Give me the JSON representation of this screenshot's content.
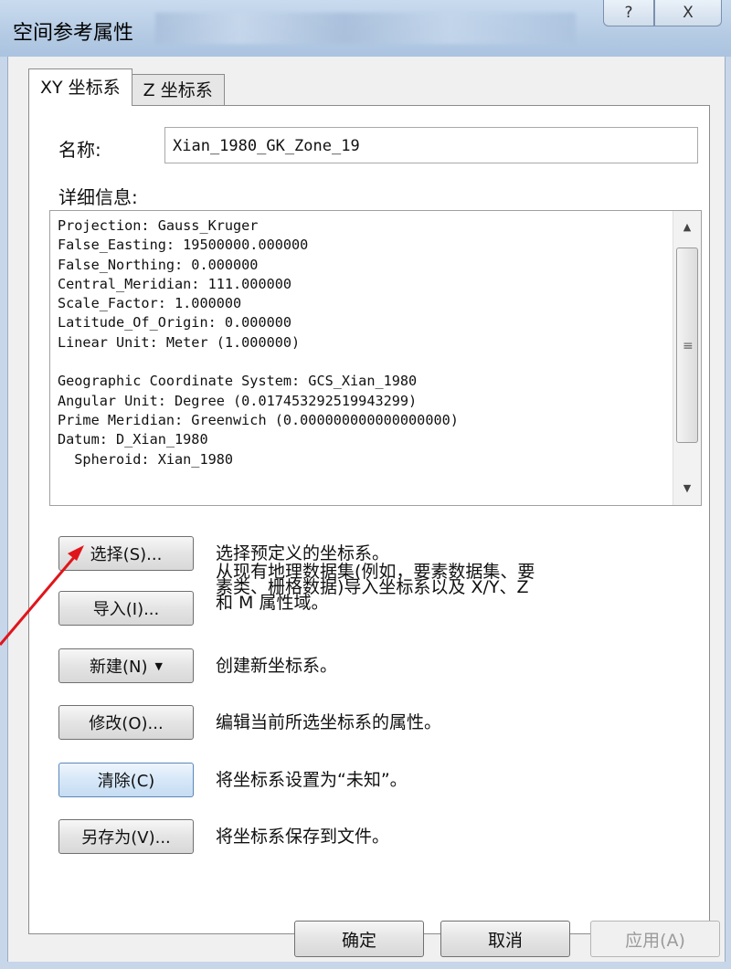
{
  "window": {
    "title": "空间参考属性",
    "help_glyph": "?",
    "close_glyph": "X"
  },
  "tabs": [
    {
      "label": "XY 坐标系"
    },
    {
      "label": "Z 坐标系"
    }
  ],
  "name": {
    "label": "名称:",
    "value": "Xian_1980_GK_Zone_19"
  },
  "details": {
    "label": "详细信息:",
    "text": "Projection: Gauss_Kruger\nFalse_Easting: 19500000.000000\nFalse_Northing: 0.000000\nCentral_Meridian: 111.000000\nScale_Factor: 1.000000\nLatitude_Of_Origin: 0.000000\nLinear Unit: Meter (1.000000)\n\nGeographic Coordinate System: GCS_Xian_1980\nAngular Unit: Degree (0.017453292519943299)\nPrime Meridian: Greenwich (0.000000000000000000)\nDatum: D_Xian_1980\n  Spheroid: Xian_1980"
  },
  "actions": [
    {
      "button": "选择(S)...",
      "desc": "选择预定义的坐标系。"
    },
    {
      "button": "导入(I)...",
      "desc": "从现有地理数据集(例如，要素数据集、要\n素类、栅格数据)导入坐标系以及 X/Y、Z\n和 M 属性域。"
    },
    {
      "button": "新建(N)",
      "desc": "创建新坐标系。"
    },
    {
      "button": "修改(O)...",
      "desc": "编辑当前所选坐标系的属性。"
    },
    {
      "button": "清除(C)",
      "desc": "将坐标系设置为“未知”。"
    },
    {
      "button": "另存为(V)...",
      "desc": "将坐标系保存到文件。"
    }
  ],
  "footer": {
    "ok": "确定",
    "cancel": "取消",
    "apply": "应用(A)"
  },
  "colors": {
    "annotation_arrow": "#e0151b",
    "titlebar": "#b5cbe4"
  }
}
